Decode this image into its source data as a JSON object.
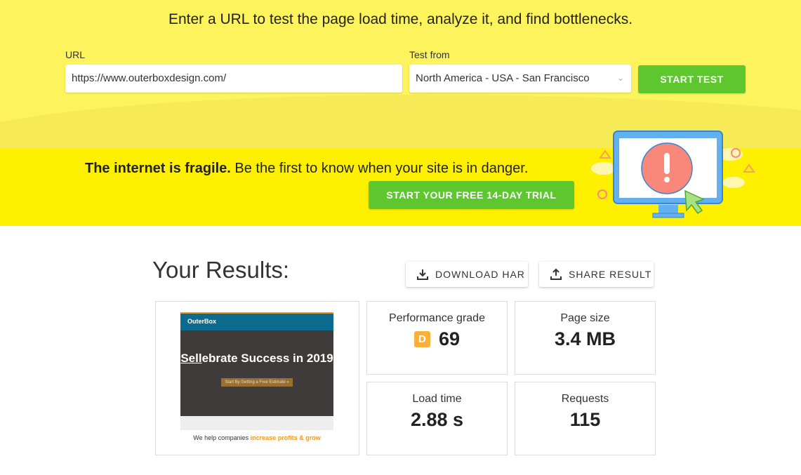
{
  "header": {
    "headline": "Enter a URL to test the page load time, analyze it, and find bottlenecks."
  },
  "form": {
    "url_label": "URL",
    "url_value": "https://www.outerboxdesign.com/",
    "test_from_label": "Test from",
    "test_from_value": "North America - USA - San Francisco",
    "start_label": "START TEST"
  },
  "banner": {
    "bold": "The internet is fragile.",
    "rest": " Be the first to know when your site is in danger.",
    "trial_label": "START YOUR FREE 14-DAY TRIAL"
  },
  "results": {
    "title": "Your Results:",
    "download_label": "DOWNLOAD HAR",
    "share_label": "SHARE RESULT",
    "screenshot": {
      "logo": "OuterBox",
      "headline_underlined": "Sell",
      "headline_rest": "ebrate Success in 2019",
      "cta": "Start By Getting a Free Estimate »",
      "tagline": "We help companies ",
      "tagline_highlight": "increase profits & grow"
    },
    "metrics": [
      {
        "label": "Performance grade",
        "grade": "D",
        "value": "69"
      },
      {
        "label": "Page size",
        "value": "3.4 MB"
      },
      {
        "label": "Load time",
        "value": "2.88 s"
      },
      {
        "label": "Requests",
        "value": "115"
      }
    ]
  },
  "colors": {
    "accent_green": "#5dc72d",
    "banner_yellow": "#fff000",
    "grade_d": "#fbb03b"
  }
}
